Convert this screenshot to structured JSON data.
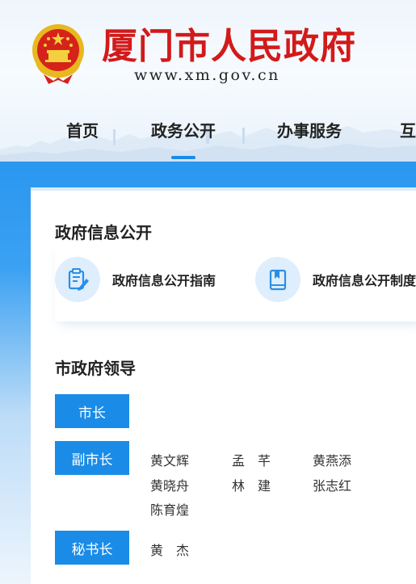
{
  "header": {
    "site_title": "厦门市人民政府",
    "site_url": "www.xm.gov.cn",
    "emblem_icon": "national-emblem-icon",
    "title_color": "#d21a1a"
  },
  "nav": {
    "items": [
      {
        "label": "首页"
      },
      {
        "label": "政务公开"
      },
      {
        "label": "办事服务"
      },
      {
        "label": "互"
      }
    ],
    "active_index": 1,
    "accent_color": "#1a8be8"
  },
  "info_disclosure": {
    "title": "政府信息公开",
    "items": [
      {
        "label": "政府信息公开指南",
        "icon": "document-edit-icon"
      },
      {
        "label": "政府信息公开制度",
        "icon": "book-icon"
      }
    ]
  },
  "leadership": {
    "title": "市政府领导",
    "badge_color": "#1a8ce8",
    "roles": [
      {
        "role": "市长",
        "names": []
      },
      {
        "role": "副市长",
        "names": [
          "黄文辉",
          "孟　芊",
          "黄燕添",
          "黄晓舟",
          "林　建",
          "张志红",
          "陈育煌"
        ]
      },
      {
        "role": "秘书长",
        "names": [
          "黄　杰"
        ]
      }
    ]
  }
}
